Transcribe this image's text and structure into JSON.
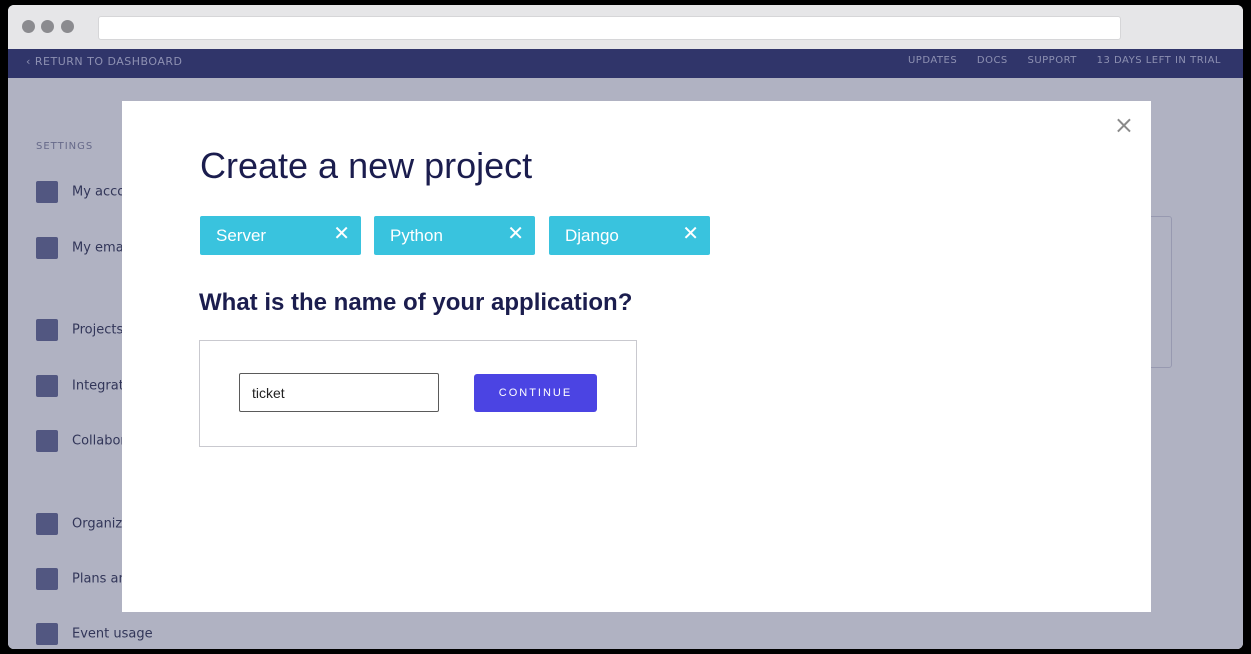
{
  "background": {
    "back_link": "‹ RETURN TO DASHBOARD",
    "top_links": [
      "UPDATES",
      "DOCS",
      "SUPPORT",
      "13 DAYS LEFT IN TRIAL"
    ],
    "sidebar_section": "SETTINGS",
    "sidebar_items": [
      "My account",
      "My emails",
      "Projects",
      "Integrations",
      "Collaborators",
      "Organization",
      "Plans and billing",
      "Event usage"
    ]
  },
  "modal": {
    "title": "Create a new project",
    "close_glyph": "×",
    "tags": [
      {
        "label": "Server",
        "remove": "✕"
      },
      {
        "label": "Python",
        "remove": "✕"
      },
      {
        "label": "Django",
        "remove": "✕"
      }
    ],
    "question": "What is the name of your application?",
    "app_name_value": "ticket",
    "continue_label": "CONTINUE"
  },
  "colors": {
    "tag": "#39c3de",
    "button": "#4b44e3",
    "heading": "#1b1d4e"
  }
}
